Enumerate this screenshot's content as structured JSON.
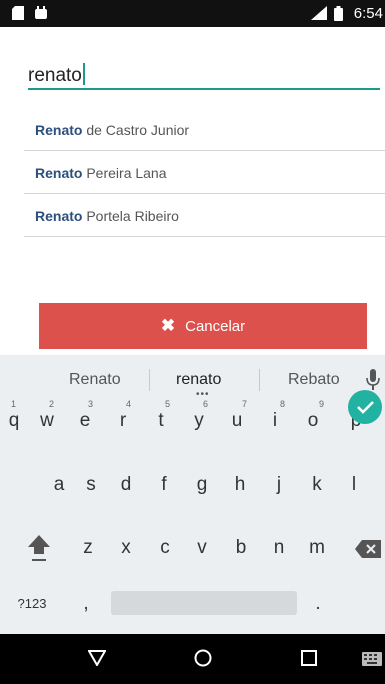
{
  "status_bar": {
    "time": "6:54"
  },
  "search": {
    "value": "renato"
  },
  "results": [
    {
      "highlight": "Renato",
      "rest": " de Castro Junior"
    },
    {
      "highlight": "Renato",
      "rest": " Pereira Lana"
    },
    {
      "highlight": "Renato",
      "rest": " Portela Ribeiro"
    }
  ],
  "cancel_button": {
    "label": "Cancelar"
  },
  "keyboard": {
    "suggestions": [
      "Renato",
      "renato",
      "Rebato"
    ],
    "row1": [
      "q",
      "w",
      "e",
      "r",
      "t",
      "y",
      "u",
      "i",
      "o",
      "p"
    ],
    "row1_hints": [
      "1",
      "2",
      "3",
      "4",
      "5",
      "6",
      "7",
      "8",
      "9"
    ],
    "row2": [
      "a",
      "s",
      "d",
      "f",
      "g",
      "h",
      "j",
      "k",
      "l"
    ],
    "row3": [
      "z",
      "x",
      "c",
      "v",
      "b",
      "n",
      "m"
    ],
    "symbols_key": "?123",
    "comma_key": ",",
    "period_key": "."
  },
  "colors": {
    "accent": "#1e9a8d",
    "cancel": "#dd514c",
    "enter": "#22b2a1"
  }
}
